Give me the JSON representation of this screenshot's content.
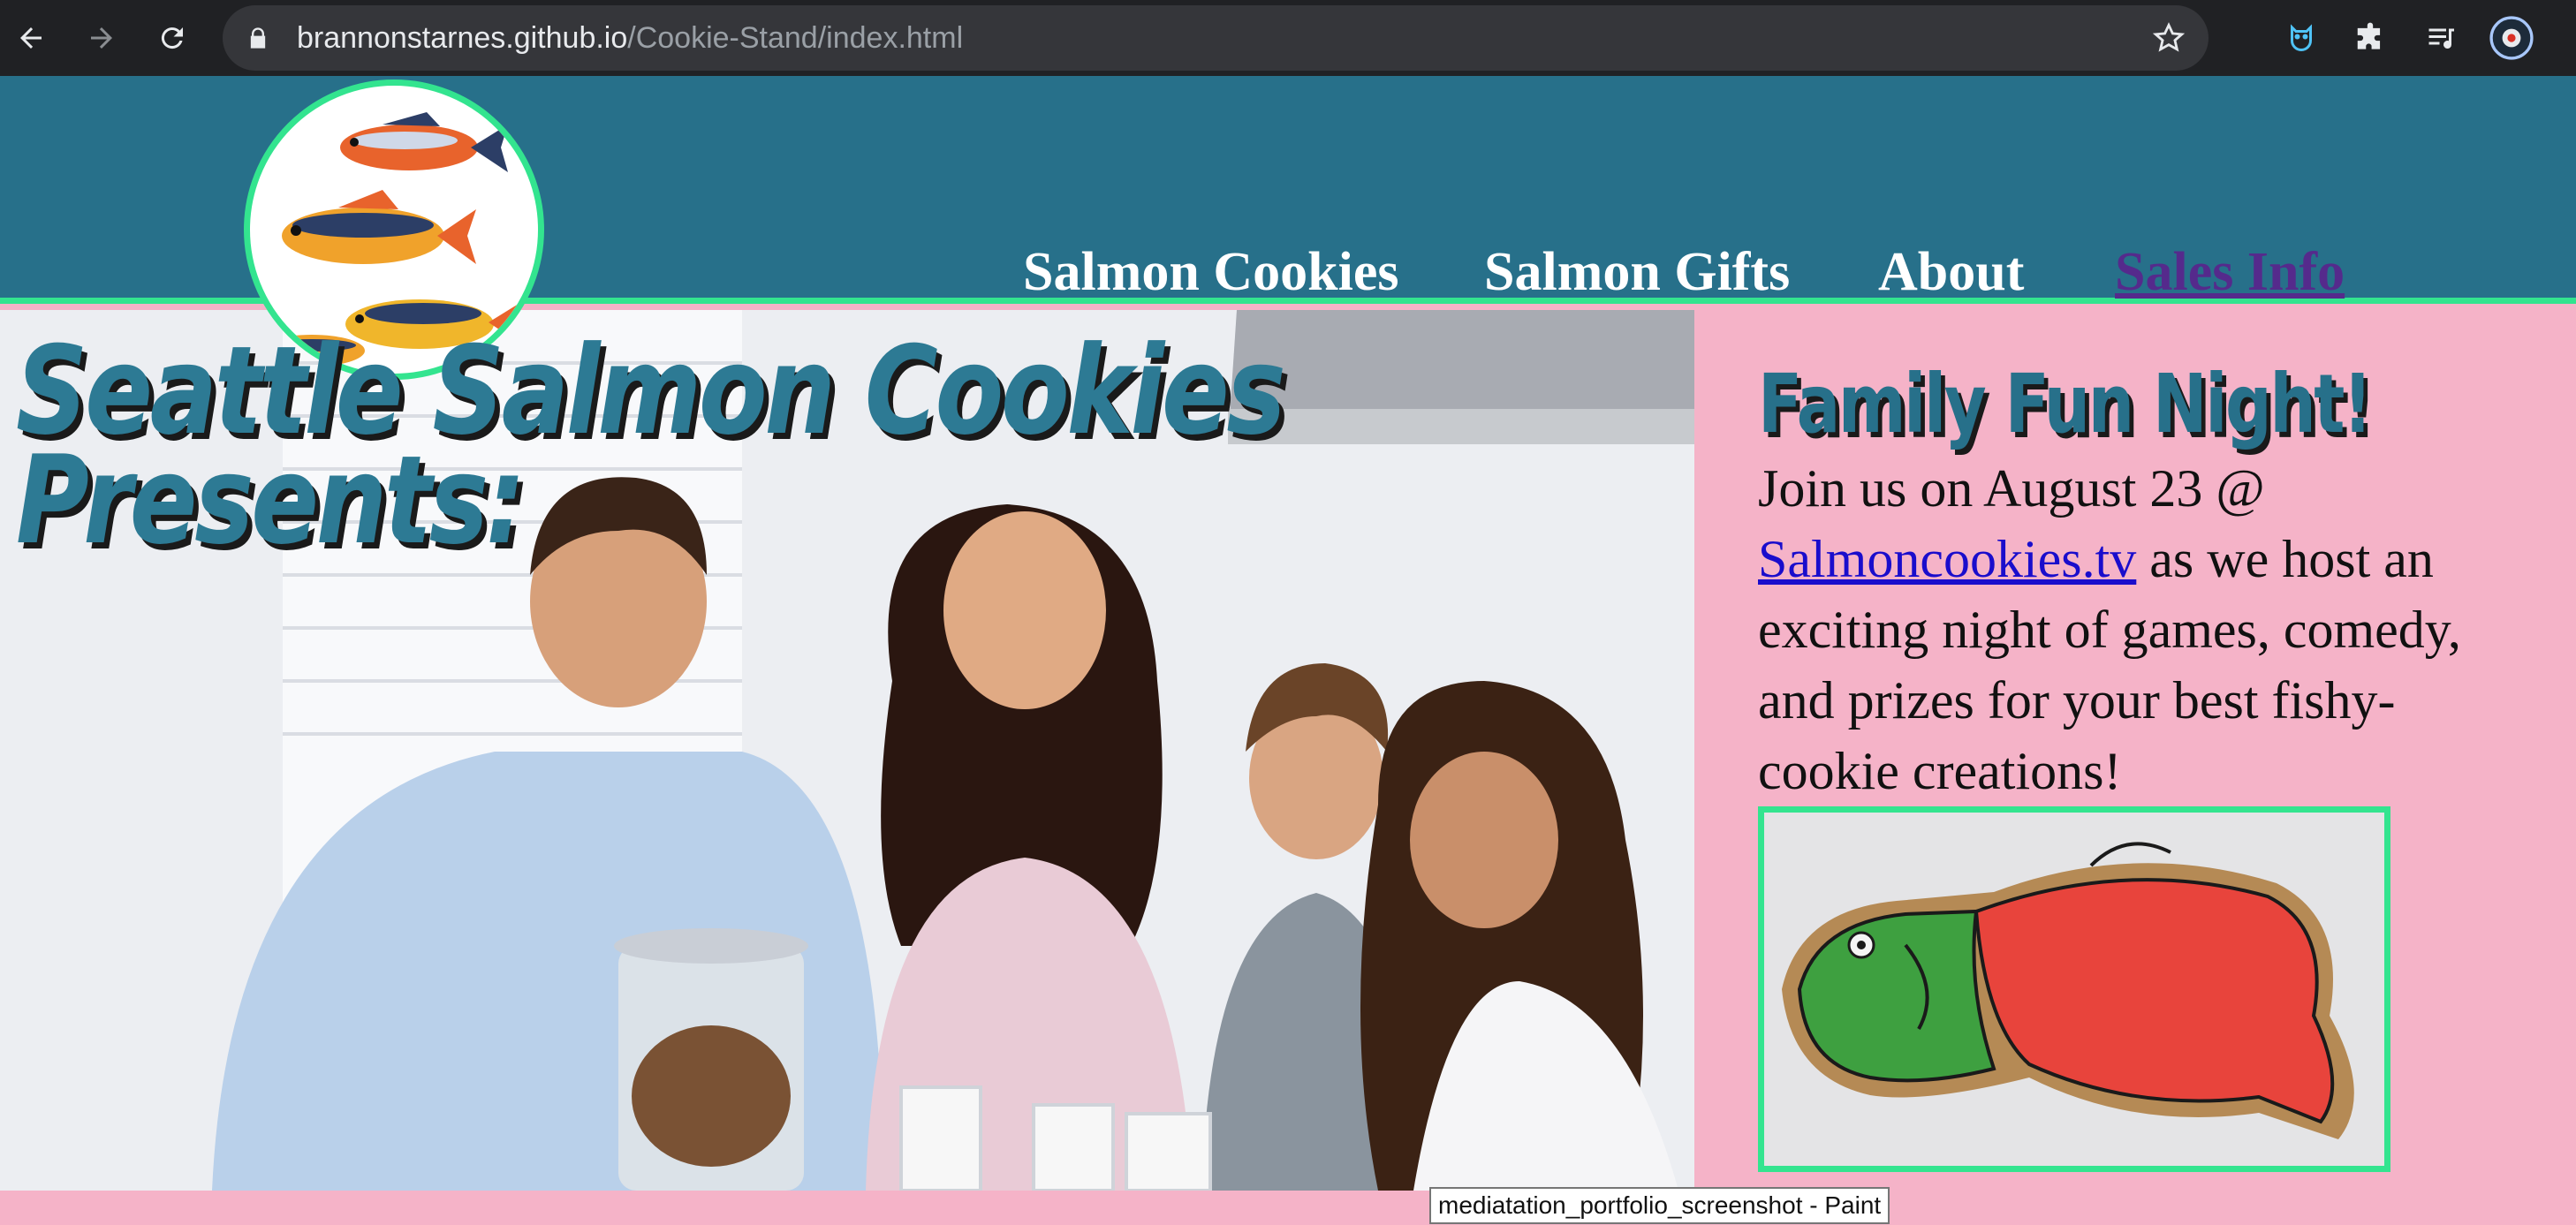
{
  "browser": {
    "url_host": "brannonstarnes.github.io",
    "url_path": "/Cookie-Stand/index.html",
    "back_icon": "arrow-left-icon",
    "forward_icon": "arrow-right-icon",
    "reload_icon": "reload-icon",
    "lock_icon": "lock-icon",
    "bookmark_icon": "star-icon",
    "extensions": [
      "owl-extension-icon",
      "puzzle-icon",
      "media-queue-icon",
      "profile-avatar-icon"
    ]
  },
  "nav": {
    "items": [
      {
        "label": "Salmon Cookies"
      },
      {
        "label": "Salmon Gifts"
      },
      {
        "label": "About"
      },
      {
        "label": "Sales Info"
      }
    ]
  },
  "hero": {
    "line1": "Seattle Salmon Cookies",
    "line2": "Presents:"
  },
  "event": {
    "title": "Family Fun Night!",
    "text_before": "Join us on August 23 @ ",
    "link": "Salmoncookies.tv",
    "text_after": " as we host an exciting night of games, comedy, and prizes for your best fishy-cookie creations!"
  },
  "tooltip": {
    "text": "mediatation_portfolio_screenshot - Paint"
  },
  "colors": {
    "header": "#27708a",
    "accent_border": "#33e48f",
    "sidebar_bg": "#f5b3c8",
    "title_teal": "#2d7a94",
    "visited_link": "#552a8c"
  }
}
